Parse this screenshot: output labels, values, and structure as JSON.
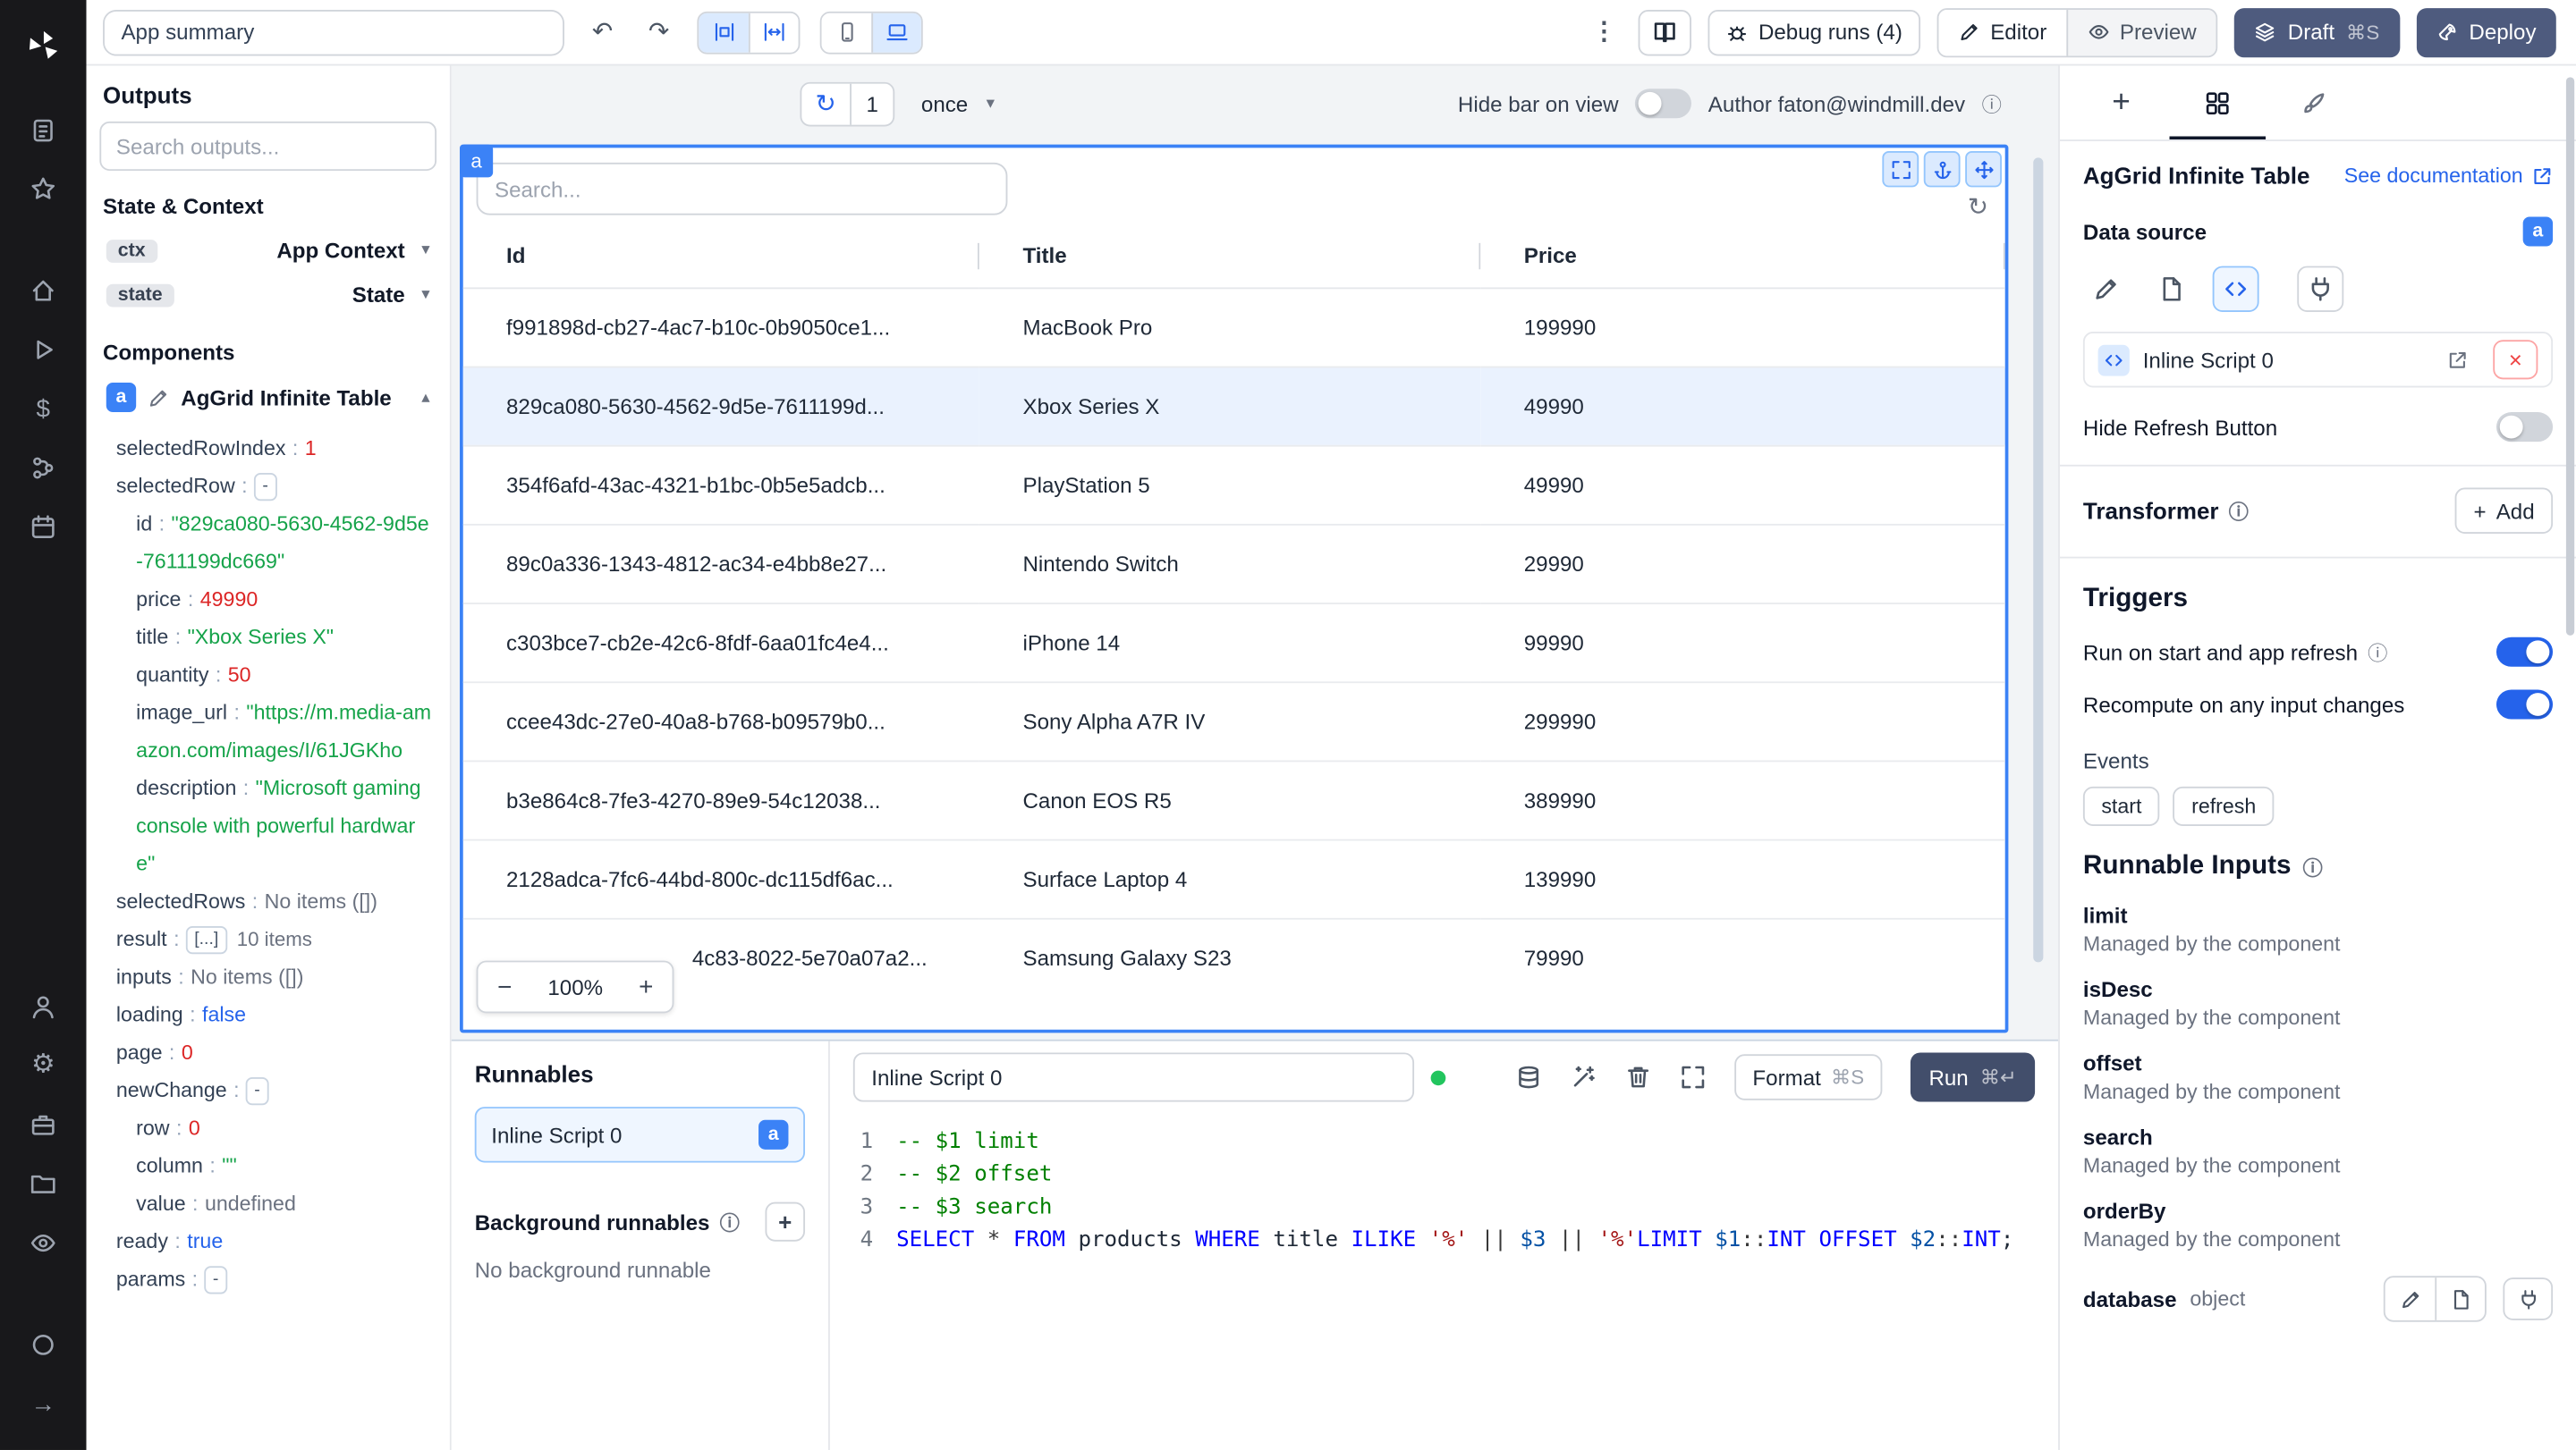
{
  "colors": {
    "accent": "#3b82f6",
    "accent_dark": "#2563eb",
    "dark_button": "#4e5b7e",
    "selected_row_bg": "#eaf2fe",
    "string_green": "#16a34a",
    "number_red": "#dc2626",
    "bool_blue": "#2563eb",
    "comment_green": "#008000",
    "keyword_blue": "#0000ff",
    "string_red": "#a31515"
  },
  "icons": {
    "undo": "↶",
    "redo": "↷",
    "kebab": "⋮",
    "refresh": "↻",
    "chevron_down": "▾",
    "chevron_up": "▴",
    "info": "ⓘ",
    "close": "×",
    "minus": "−",
    "plus": "+",
    "arrow_right": "→",
    "gear": "⚙",
    "dollar": "$"
  },
  "topbar": {
    "app_summary": "App summary",
    "debug_runs_label": "Debug runs (4)",
    "editor_label": "Editor",
    "preview_label": "Preview",
    "draft_label": "Draft",
    "draft_shortcut": "⌘S",
    "deploy_label": "Deploy"
  },
  "outputs_panel": {
    "title": "Outputs",
    "search_placeholder": "Search outputs...",
    "state_context_label": "State & Context",
    "ctx_badge": "ctx",
    "ctx_label": "App Context",
    "state_badge": "state",
    "state_label": "State",
    "components_label": "Components",
    "component_badge": "a",
    "component_name": "AgGrid Infinite Table",
    "tree": [
      {
        "key": "selectedRowIndex",
        "value": "1",
        "type": "num",
        "indent": 0
      },
      {
        "key": "selectedRow",
        "value": "-",
        "type": "dash",
        "indent": 0
      },
      {
        "key": "id",
        "value": "\"829ca080-5630-4562-9d5e-7611199dc669\"",
        "type": "str",
        "indent": 1
      },
      {
        "key": "price",
        "value": "49990",
        "type": "num",
        "indent": 1
      },
      {
        "key": "title",
        "value": "\"Xbox Series X\"",
        "type": "str",
        "indent": 1
      },
      {
        "key": "quantity",
        "value": "50",
        "type": "num",
        "indent": 1
      },
      {
        "key": "image_url",
        "value": "\"https://m.media-amazon.com/images/I/61JGKho",
        "type": "str",
        "indent": 1
      },
      {
        "key": "description",
        "value": "\"Microsoft gaming console with powerful hardware\"",
        "type": "str",
        "indent": 1
      },
      {
        "key": "selectedRows",
        "value": "No items ([])",
        "type": "plain",
        "indent": 0
      },
      {
        "key": "result",
        "value": "[...]",
        "extra": "10 items",
        "type": "box",
        "indent": 0
      },
      {
        "key": "inputs",
        "value": "No items ([])",
        "type": "plain",
        "indent": 0
      },
      {
        "key": "loading",
        "value": "false",
        "type": "bool",
        "indent": 0
      },
      {
        "key": "page",
        "value": "0",
        "type": "num",
        "indent": 0
      },
      {
        "key": "newChange",
        "value": "-",
        "type": "dash",
        "indent": 0
      },
      {
        "key": "row",
        "value": "0",
        "type": "num",
        "indent": 1
      },
      {
        "key": "column",
        "value": "\"\"",
        "type": "str",
        "indent": 1
      },
      {
        "key": "value",
        "value": "undefined",
        "type": "plain",
        "indent": 1
      },
      {
        "key": "ready",
        "value": "true",
        "type": "bool",
        "indent": 0
      },
      {
        "key": "params",
        "value": "-",
        "type": "dash",
        "indent": 0
      }
    ]
  },
  "canvas": {
    "refresh_count": "1",
    "interval_value": "once",
    "hide_bar_label": "Hide bar on view",
    "author_label": "Author faton@windmill.dev",
    "component_tag": "a",
    "grid_search_placeholder": "Search...",
    "zoom_value": "100%",
    "table": {
      "columns": [
        "Id",
        "Title",
        "Price"
      ],
      "selected_index": 1,
      "rows": [
        {
          "id": "f991898d-cb27-4ac7-b10c-0b9050ce1...",
          "title": "MacBook Pro",
          "price": "199990"
        },
        {
          "id": "829ca080-5630-4562-9d5e-7611199d...",
          "title": "Xbox Series X",
          "price": "49990"
        },
        {
          "id": "354f6afd-43ac-4321-b1bc-0b5e5adcb...",
          "title": "PlayStation 5",
          "price": "49990"
        },
        {
          "id": "89c0a336-1343-4812-ac34-e4bb8e27...",
          "title": "Nintendo Switch",
          "price": "29990"
        },
        {
          "id": "c303bce7-cb2e-42c6-8fdf-6aa01fc4e4...",
          "title": "iPhone 14",
          "price": "99990"
        },
        {
          "id": "ccee43dc-27e0-40a8-b768-b09579b0...",
          "title": "Sony Alpha A7R IV",
          "price": "299990"
        },
        {
          "id": "b3e864c8-7fe3-4270-89e9-54c12038...",
          "title": "Canon EOS R5",
          "price": "389990"
        },
        {
          "id": "2128adca-7fc6-44bd-800c-dc115df6ac...",
          "title": "Surface Laptop 4",
          "price": "139990"
        },
        {
          "id": "4c83-8022-5e70a07a2...",
          "title": "Samsung Galaxy S23",
          "price": "79990",
          "pad": true
        }
      ]
    }
  },
  "runnables": {
    "title": "Runnables",
    "item_label": "Inline Script 0",
    "item_badge": "a",
    "background_label": "Background runnables",
    "background_empty": "No background runnable"
  },
  "editor": {
    "script_name": "Inline Script 0",
    "format_label": "Format",
    "format_shortcut": "⌘S",
    "run_label": "Run",
    "run_shortcut": "⌘↵",
    "code": [
      [
        {
          "t": "-- $1 limit",
          "c": "com"
        }
      ],
      [
        {
          "t": "-- $2 offset",
          "c": "com"
        }
      ],
      [
        {
          "t": "-- $3 search",
          "c": "com"
        }
      ],
      [
        {
          "t": "SELECT",
          "c": "kw"
        },
        {
          "t": " ",
          "c": "pl"
        },
        {
          "t": "*",
          "c": "op"
        },
        {
          "t": " ",
          "c": "pl"
        },
        {
          "t": "FROM",
          "c": "kw"
        },
        {
          "t": " products ",
          "c": "pl"
        },
        {
          "t": "WHERE",
          "c": "kw"
        },
        {
          "t": " title ",
          "c": "pl"
        },
        {
          "t": "ILIKE",
          "c": "kw"
        },
        {
          "t": " ",
          "c": "pl"
        },
        {
          "t": "'%'",
          "c": "str"
        },
        {
          "t": " ",
          "c": "pl"
        },
        {
          "t": "||",
          "c": "op"
        },
        {
          "t": " ",
          "c": "pl"
        },
        {
          "t": "$3",
          "c": "var"
        },
        {
          "t": " ",
          "c": "pl"
        },
        {
          "t": "||",
          "c": "op"
        },
        {
          "t": " ",
          "c": "pl"
        },
        {
          "t": "'%'",
          "c": "str"
        },
        {
          "t": "LIMIT",
          "c": "kw"
        },
        {
          "t": " ",
          "c": "pl"
        },
        {
          "t": "$1",
          "c": "var"
        },
        {
          "t": "::",
          "c": "op"
        },
        {
          "t": "INT",
          "c": "kw"
        },
        {
          "t": " ",
          "c": "pl"
        },
        {
          "t": "OFFSET",
          "c": "kw"
        },
        {
          "t": " ",
          "c": "pl"
        },
        {
          "t": "$2",
          "c": "var"
        },
        {
          "t": "::",
          "c": "op"
        },
        {
          "t": "INT",
          "c": "kw"
        },
        {
          "t": ";",
          "c": "pl"
        }
      ]
    ]
  },
  "settings": {
    "component_title": "AgGrid Infinite Table",
    "doc_link_label": "See documentation",
    "data_source_label": "Data source",
    "badge": "a",
    "script_ref_label": "Inline Script 0",
    "hide_refresh_label": "Hide Refresh Button",
    "transformer_label": "Transformer",
    "add_label": "Add",
    "triggers_label": "Triggers",
    "trigger_start_label": "Run on start and app refresh",
    "trigger_recompute_label": "Recompute on any input changes",
    "events_label": "Events",
    "events": [
      "start",
      "refresh"
    ],
    "runnable_inputs_label": "Runnable Inputs",
    "fields": [
      {
        "name": "limit",
        "desc": "Managed by the component"
      },
      {
        "name": "isDesc",
        "desc": "Managed by the component"
      },
      {
        "name": "offset",
        "desc": "Managed by the component"
      },
      {
        "name": "search",
        "desc": "Managed by the component"
      },
      {
        "name": "orderBy",
        "desc": "Managed by the component"
      }
    ],
    "database_label": "database",
    "database_type": "object"
  }
}
